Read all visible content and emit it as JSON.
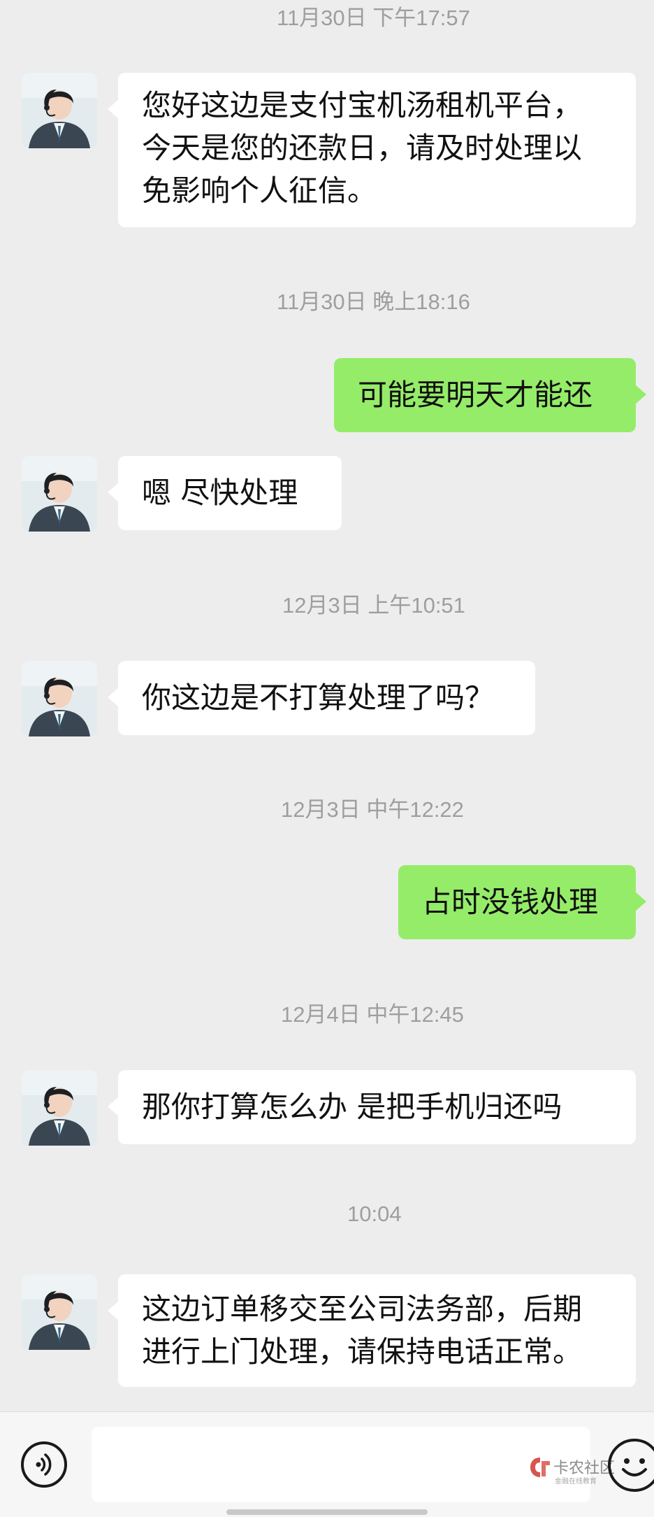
{
  "messages": [
    {
      "timestamp": "11月30日 下午17:57"
    },
    {
      "from": "agent",
      "text": "您好这边是支付宝机汤租机平台，\n今天是您的还款日，请及时处理以\n免影响个人征信。"
    },
    {
      "timestamp": "11月30日 晚上18:16"
    },
    {
      "from": "me",
      "text": "可能要明天才能还"
    },
    {
      "from": "agent",
      "text": "嗯  尽快处理"
    },
    {
      "timestamp": "12月3日 上午10:51"
    },
    {
      "from": "agent",
      "text": "你这边是不打算处理了吗？"
    },
    {
      "timestamp": "12月3日 中午12:22"
    },
    {
      "from": "me",
      "text": "占时没钱处理"
    },
    {
      "timestamp": "12月4日 中午12:45"
    },
    {
      "from": "agent",
      "text": "那你打算怎么办 是把手机归还吗"
    },
    {
      "timestamp": "10:04"
    },
    {
      "from": "agent",
      "text": "这边订单移交至公司法务部，后期\n进行上门处理，请保持电话正常。"
    }
  ],
  "input_bar": {
    "voice_icon": "voice-icon",
    "emoji_icon": "emoji-icon",
    "input_value": ""
  },
  "watermark": {
    "title": "卡农社区",
    "subtitle": "金融在线教育"
  },
  "colors": {
    "background": "#ededed",
    "incoming_bubble": "#ffffff",
    "outgoing_bubble": "#95ec69",
    "timestamp_text": "#9e9e9e"
  }
}
